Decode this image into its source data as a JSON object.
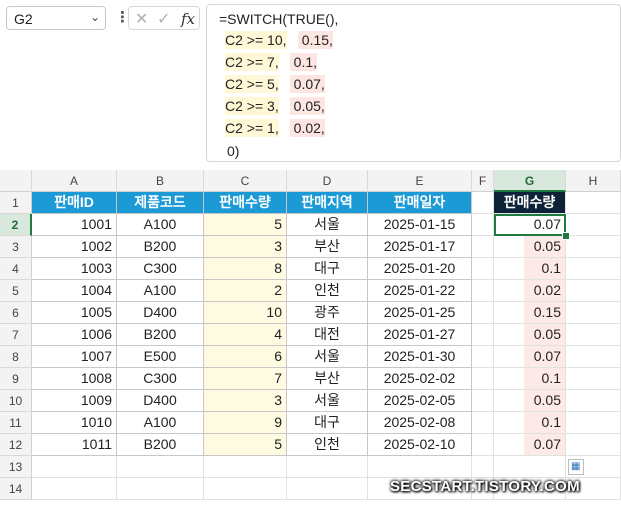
{
  "name_box": {
    "value": "G2"
  },
  "icons": {
    "cancel": "✕",
    "confirm": "✓",
    "fx": "fx",
    "more": "⋮",
    "dropdown": "⌄"
  },
  "formula_lines": [
    "=SWITCH(TRUE(),",
    "C2 >= 10, 0.15,",
    "C2 >= 7, 0.1,",
    "C2 >= 5, 0.07,",
    "C2 >= 3, 0.05,",
    "C2 >= 1, 0.02,",
    "0)"
  ],
  "formula_parts": [
    {
      "cond": "C2 >= 10,",
      "val": " 0.15,"
    },
    {
      "cond": "C2 >= 7,",
      "val": " 0.1,"
    },
    {
      "cond": "C2 >= 5,",
      "val": " 0.07,"
    },
    {
      "cond": "C2 >= 3,",
      "val": " 0.05,"
    },
    {
      "cond": "C2 >= 1,",
      "val": " 0.02,"
    }
  ],
  "columns": [
    "A",
    "B",
    "C",
    "D",
    "E",
    "F",
    "G",
    "H"
  ],
  "rows": [
    "1",
    "2",
    "3",
    "4",
    "5",
    "6",
    "7",
    "8",
    "9",
    "10",
    "11",
    "12",
    "13",
    "14"
  ],
  "table_headers": [
    "판매ID",
    "제품코드",
    "판매수량",
    "판매지역",
    "판매일자"
  ],
  "result_header": "판매수량",
  "table": [
    [
      "1001",
      "A100",
      "5",
      "서울",
      "2025-01-15"
    ],
    [
      "1002",
      "B200",
      "3",
      "부산",
      "2025-01-17"
    ],
    [
      "1003",
      "C300",
      "8",
      "대구",
      "2025-01-20"
    ],
    [
      "1004",
      "A100",
      "2",
      "인천",
      "2025-01-22"
    ],
    [
      "1005",
      "D400",
      "10",
      "광주",
      "2025-01-25"
    ],
    [
      "1006",
      "B200",
      "4",
      "대전",
      "2025-01-27"
    ],
    [
      "1007",
      "E500",
      "6",
      "서울",
      "2025-01-30"
    ],
    [
      "1008",
      "C300",
      "7",
      "부산",
      "2025-02-02"
    ],
    [
      "1009",
      "D400",
      "3",
      "서울",
      "2025-02-05"
    ],
    [
      "1010",
      "A100",
      "9",
      "대구",
      "2025-02-08"
    ],
    [
      "1011",
      "B200",
      "5",
      "인천",
      "2025-02-10"
    ]
  ],
  "results": [
    "0.07",
    "0.05",
    "0.1",
    "0.02",
    "0.15",
    "0.05",
    "0.07",
    "0.1",
    "0.05",
    "0.1",
    "0.07"
  ],
  "active_cell": "G2",
  "watermark": "SECSTART.TISTORY.COM"
}
